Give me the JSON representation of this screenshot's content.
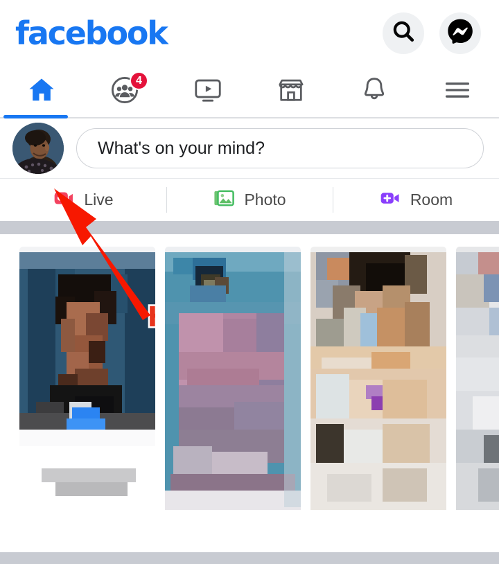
{
  "app": {
    "name": "facebook",
    "brand_color": "#1877F2"
  },
  "topbar": {
    "logo_text": "facebook",
    "search_icon": "search-icon",
    "messenger_icon": "messenger-icon"
  },
  "navbar": {
    "tabs": [
      {
        "name": "home",
        "icon": "home-icon",
        "active": true,
        "badge": ""
      },
      {
        "name": "friends",
        "icon": "friends-icon",
        "active": false,
        "badge": "4"
      },
      {
        "name": "watch",
        "icon": "watch-video-icon",
        "active": false,
        "badge": ""
      },
      {
        "name": "marketplace",
        "icon": "marketplace-store-icon",
        "active": false,
        "badge": ""
      },
      {
        "name": "notifications",
        "icon": "bell-icon",
        "active": false,
        "badge": ""
      },
      {
        "name": "menu",
        "icon": "hamburger-menu-icon",
        "active": false,
        "badge": ""
      }
    ],
    "friends_badge_count": "4",
    "badge_color": "#E4123B",
    "active_underline_color": "#1877F2"
  },
  "composer": {
    "avatar_alt": "profile-photo",
    "placeholder": "What's on your mind?"
  },
  "actions": [
    {
      "label": "Live",
      "icon": "live-video-icon",
      "color": "#F3425F"
    },
    {
      "label": "Photo",
      "icon": "photo-gallery-icon",
      "color": "#45BD62"
    },
    {
      "label": "Room",
      "icon": "video-room-icon",
      "color": "#8A3FFC"
    }
  ],
  "stories": {
    "cards": [
      {
        "name": "story-card-1",
        "overlay_logo": "H",
        "overlay_logo_color": "#E8341C"
      },
      {
        "name": "story-card-2",
        "overlay_logo": "",
        "overlay_logo_color": ""
      },
      {
        "name": "story-card-3",
        "overlay_logo": "",
        "overlay_logo_color": ""
      },
      {
        "name": "story-card-4",
        "overlay_logo": "",
        "overlay_logo_color": ""
      }
    ]
  },
  "annotation": {
    "arrow_color": "#F71800",
    "arrow_points_to": "profile-avatar"
  }
}
